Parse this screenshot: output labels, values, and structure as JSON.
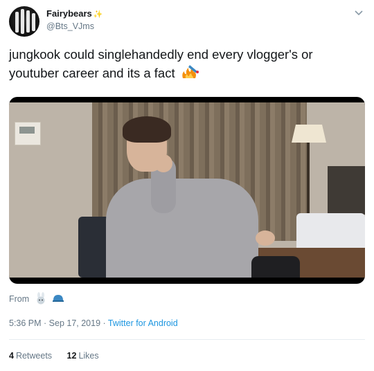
{
  "author": {
    "display_name": "Fairybears",
    "name_emoji": "✨",
    "handle": "@Bts_VJms"
  },
  "tweet": {
    "text": "jungkook could singlehandedly end every vlogger's or youtuber career and its a fact",
    "emoji_icon": "fire-crown-icon"
  },
  "media": {
    "type": "video"
  },
  "source_note": {
    "label": "From",
    "icons": [
      "bunny-icon",
      "blue-cap-icon"
    ]
  },
  "meta": {
    "time_date": "5:36 PM · Sep 17, 2019 ·",
    "client": "Twitter for Android"
  },
  "stats": {
    "retweets_count": "4",
    "retweets_label": "Retweets",
    "likes_count": "12",
    "likes_label": "Likes"
  },
  "colors": {
    "link": "#1b95e0",
    "muted": "#657786",
    "text": "#14171a"
  }
}
